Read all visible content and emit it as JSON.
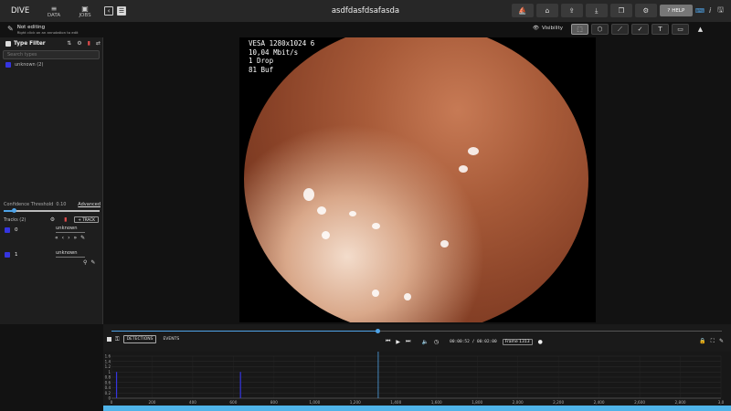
{
  "app": {
    "brand": "DIVE",
    "title": "asdfdasfdsafasda",
    "nav": [
      {
        "label": "DATA",
        "icon": "database-icon"
      },
      {
        "label": "JOBS",
        "icon": "briefcase-icon"
      }
    ],
    "help_label": "HELP"
  },
  "edit_status": {
    "title": "Not editing",
    "hint": "Right click on an annotation to edit"
  },
  "visibility_label": "Visibility",
  "type_filter": {
    "title": "Type Filter",
    "search_placeholder": "Search types",
    "types": [
      {
        "label": "unknown (2)",
        "color": "#3535e0"
      }
    ]
  },
  "confidence": {
    "label": "Confidence Threshold",
    "value": "0.10",
    "advanced_label": "Advanced",
    "level": 0.1
  },
  "tracks": {
    "header": "Tracks (2)",
    "add_label": "+ TRACK",
    "items": [
      {
        "id": "0",
        "type": "unknown"
      },
      {
        "id": "1",
        "type": "unknown"
      }
    ]
  },
  "video": {
    "osd_lines": [
      "VESA 1280x1024 6",
      "10,04 Mbit/s",
      "1 Drop",
      "81 Buf"
    ]
  },
  "timeline": {
    "tabs": [
      "DETECTIONS",
      "EVENTS"
    ],
    "current_time": "00:00:52",
    "total_time": "00:02:00",
    "frame_label": "Frame 1313",
    "progress": 0.437
  },
  "chart_data": {
    "type": "bar",
    "x_ticks": [
      0,
      200,
      400,
      600,
      800,
      1000,
      1200,
      1400,
      1600,
      1800,
      2000,
      2200,
      2400,
      2600,
      2800,
      3000
    ],
    "x_tick_labels": [
      "0",
      "200",
      "400",
      "600",
      "800",
      "1,000",
      "1,200",
      "1,400",
      "1,600",
      "1,800",
      "2,000",
      "2,200",
      "2,400",
      "2,600",
      "2,800",
      "3,0"
    ],
    "y_ticks": [
      "1.6",
      "1.4",
      "1.2",
      "1",
      "0.8",
      "0.6",
      "0.4",
      "0.2",
      "0"
    ],
    "xlim": [
      0,
      3000
    ],
    "ylim": [
      0,
      1.6
    ],
    "bars": [
      {
        "x": 25,
        "y": 1
      },
      {
        "x": 635,
        "y": 1
      }
    ],
    "cursor_frame": 1313,
    "colors": {
      "bar": "#3535e0",
      "cursor": "#4fa4e8"
    }
  }
}
